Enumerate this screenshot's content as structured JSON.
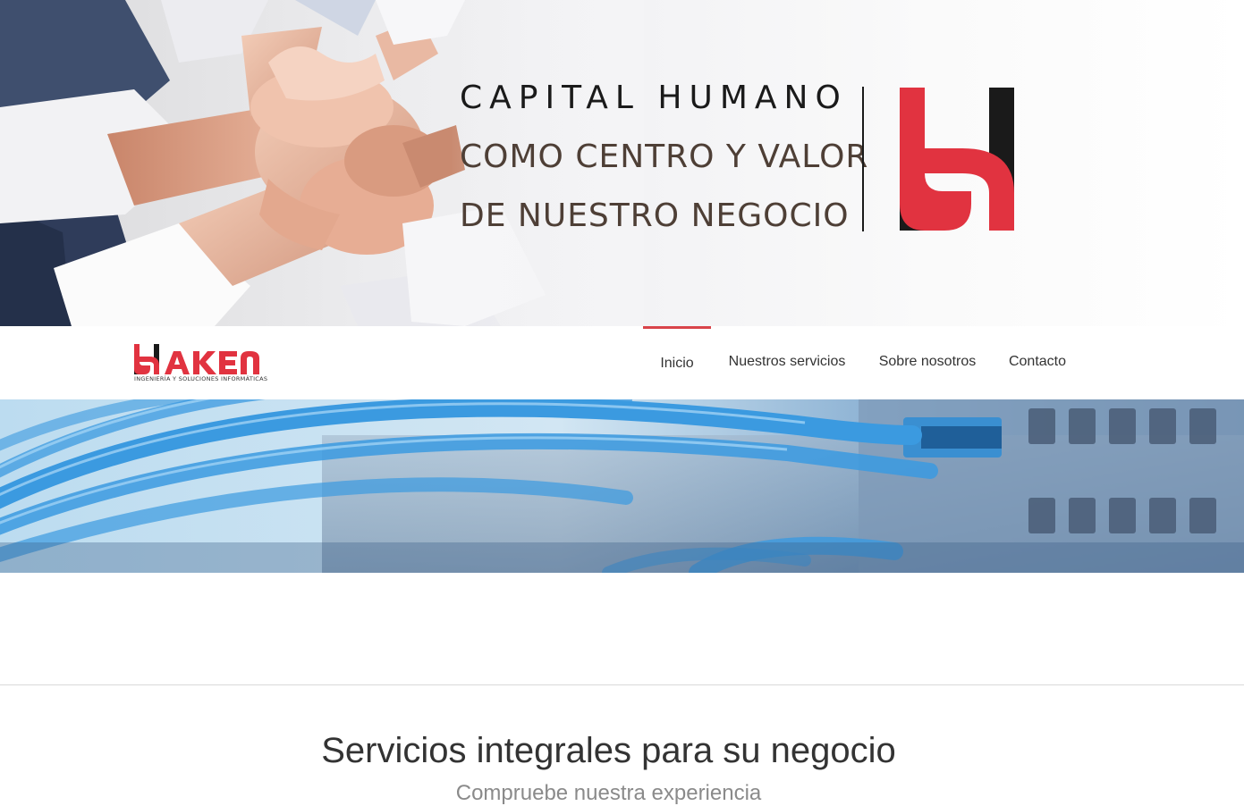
{
  "hero": {
    "line1": "CAPITAL HUMANO",
    "line2": "COMO CENTRO Y VALOR",
    "line3": "DE NUESTRO NEGOCIO",
    "logo_icon": "haken-h-logo-icon"
  },
  "brand": {
    "name": "HAKEN",
    "tagline": "INGENIERÍA Y SOLUCIONES INFORMÁTICAS",
    "logo_icon": "haken-logo-icon"
  },
  "nav": {
    "items": [
      {
        "label": "Inicio",
        "active": true
      },
      {
        "label": "Nuestros servicios",
        "active": false
      },
      {
        "label": "Sobre nosotros",
        "active": false
      },
      {
        "label": "Contacto",
        "active": false
      }
    ]
  },
  "banner": {
    "image": "network-cables-image"
  },
  "section": {
    "title": "Servicios integrales para su negocio",
    "subtitle": "Compruebe nuestra experiencia"
  },
  "colors": {
    "accent": "#d9444a",
    "logo_red": "#e13340",
    "logo_black": "#1a1a1a",
    "hero_text_brown": "#4e3f36"
  }
}
